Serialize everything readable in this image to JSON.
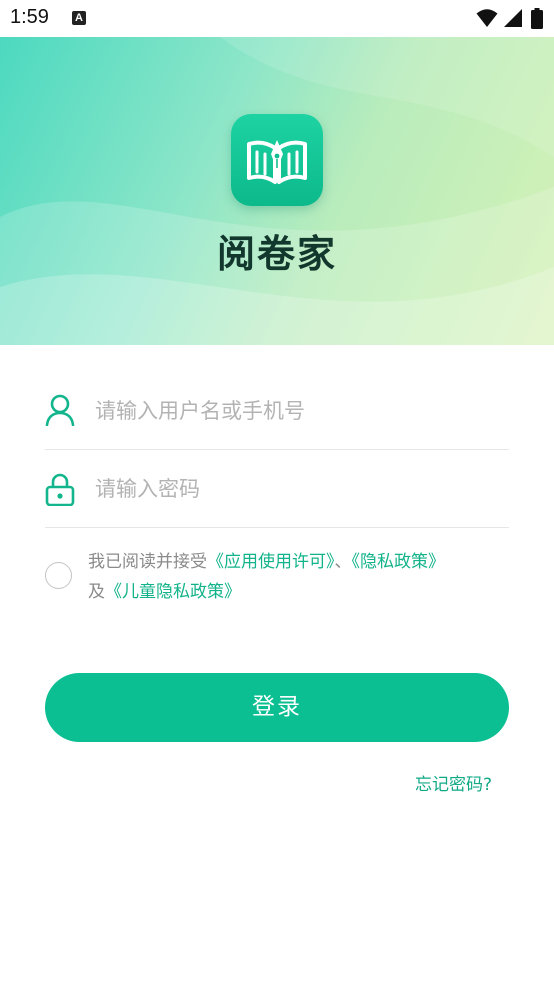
{
  "status_bar": {
    "time": "1:59",
    "notification_icon": "A"
  },
  "app": {
    "name": "阅卷家"
  },
  "form": {
    "username_placeholder": "请输入用户名或手机号",
    "password_placeholder": "请输入密码",
    "username_value": "",
    "password_value": ""
  },
  "agreement": {
    "prefix": "我已阅读并接受",
    "license_link": "《应用使用许可》",
    "separator": "、",
    "privacy_link": "《隐私政策》",
    "and_text": "及",
    "child_privacy_link": "《儿童隐私政策》",
    "checked": false
  },
  "buttons": {
    "login": "登录",
    "forgot_password": "忘记密码?"
  },
  "colors": {
    "accent": "#0bbf93",
    "link": "#12b38a",
    "brand_text": "#12382e"
  },
  "icons": [
    "wifi-icon",
    "signal-icon",
    "battery-icon",
    "user-icon",
    "lock-icon",
    "book-pen-logo-icon"
  ]
}
